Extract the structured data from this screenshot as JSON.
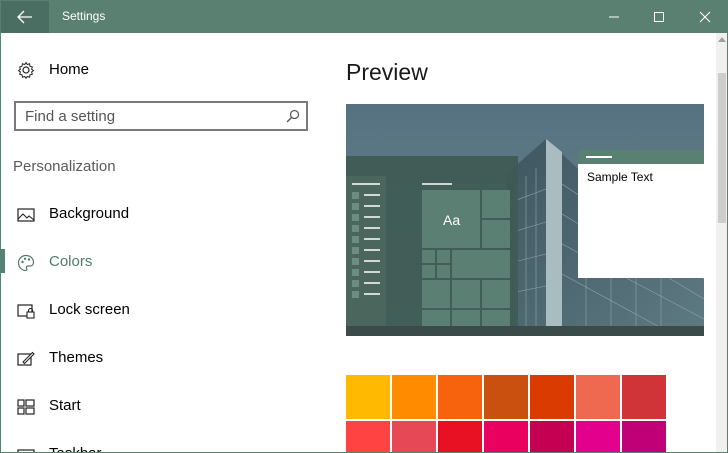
{
  "window": {
    "title": "Settings",
    "accent_color": "#5a8071"
  },
  "sidebar": {
    "home_label": "Home",
    "search": {
      "placeholder": "Find a setting"
    },
    "section_title": "Personalization",
    "items": [
      {
        "label": "Background",
        "icon": "picture-icon"
      },
      {
        "label": "Colors",
        "icon": "palette-icon",
        "active": true
      },
      {
        "label": "Lock screen",
        "icon": "lock-screen-icon"
      },
      {
        "label": "Themes",
        "icon": "themes-icon"
      },
      {
        "label": "Start",
        "icon": "start-icon"
      },
      {
        "label": "Taskbar",
        "icon": "taskbar-icon"
      }
    ]
  },
  "main": {
    "preview_title": "Preview",
    "preview": {
      "tile_label": "Aa",
      "sample_text": "Sample Text"
    },
    "swatch_rows": [
      [
        "#ffb900",
        "#ff8c00",
        "#f7630c",
        "#ca5010",
        "#da3b01",
        "#ef6950",
        "#d13438"
      ],
      [
        "#ff4343",
        "#e74856",
        "#e81123",
        "#ea005e",
        "#c30052",
        "#e3008c",
        "#bf0077"
      ]
    ]
  }
}
